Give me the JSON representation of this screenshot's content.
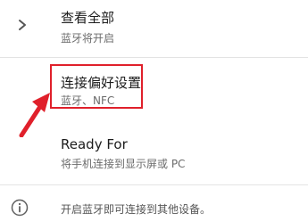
{
  "items": [
    {
      "title": "查看全部",
      "subtitle": "蓝牙将开启"
    },
    {
      "title": "连接偏好设置",
      "subtitle": "蓝牙、NFC"
    },
    {
      "title": "Ready For",
      "subtitle": "将手机连接到显示屏或 PC"
    }
  ],
  "info": {
    "text": "开启蓝牙即可连接到其他设备。"
  },
  "colors": {
    "highlight": "#e0202b",
    "title": "#1c1c1c",
    "subtitle": "#6b6b6b"
  },
  "icons": {
    "chevron": "chevron-right-icon",
    "info": "info-icon",
    "annotation": "red-arrow-icon"
  }
}
